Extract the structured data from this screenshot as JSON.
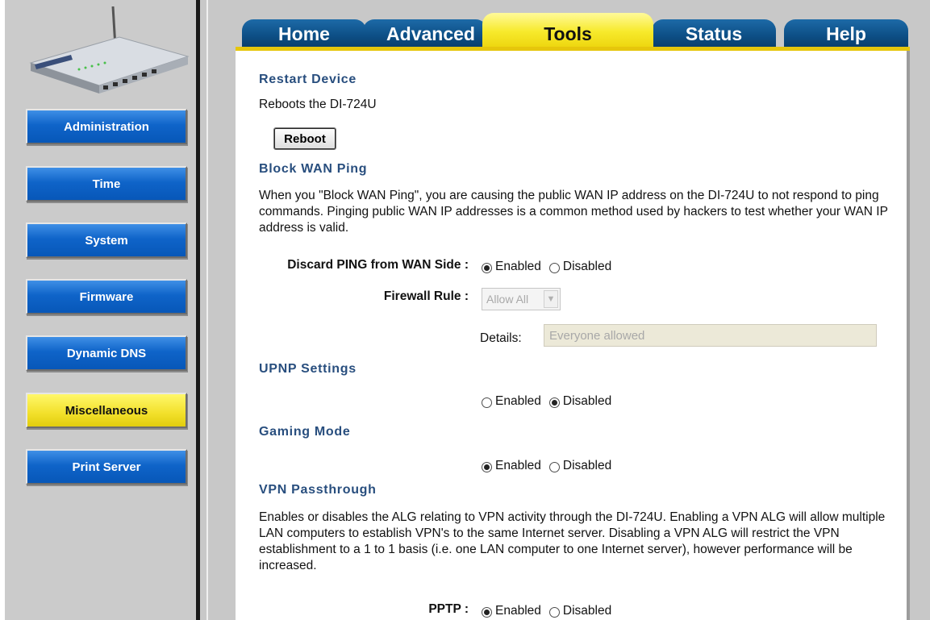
{
  "sidebar": {
    "items": [
      {
        "label": "Administration"
      },
      {
        "label": "Time"
      },
      {
        "label": "System"
      },
      {
        "label": "Firmware"
      },
      {
        "label": "Dynamic DNS"
      },
      {
        "label": "Miscellaneous",
        "active": true
      },
      {
        "label": "Print Server"
      }
    ]
  },
  "tabs": [
    {
      "label": "Home"
    },
    {
      "label": "Advanced"
    },
    {
      "label": "Tools",
      "active": true
    },
    {
      "label": "Status"
    },
    {
      "label": "Help"
    }
  ],
  "colors": {
    "tab_blue": "#0d4f86",
    "tab_active_yellow": "#f7ea2c",
    "side_button_blue": "#0f64c9",
    "heading_blue": "#284e7e"
  },
  "restart": {
    "heading": "Restart Device",
    "desc": "Reboots the DI-724U",
    "button": "Reboot"
  },
  "block_wan": {
    "heading": "Block WAN Ping",
    "desc": "When you \"Block WAN Ping\", you are causing the public WAN IP address on the DI-724U to not respond to ping commands. Pinging public WAN IP addresses is a common method used by hackers to test whether your WAN IP address is valid.",
    "discard_label": "Discard PING from WAN Side :",
    "discard_selected": "Enabled",
    "firewall_label": "Firewall Rule :",
    "firewall_value": "Allow All",
    "details_label": "Details:",
    "details_value": "Everyone allowed"
  },
  "upnp": {
    "heading": "UPNP Settings",
    "selected": "Disabled"
  },
  "gaming": {
    "heading": "Gaming Mode",
    "selected": "Enabled"
  },
  "vpn": {
    "heading": "VPN Passthrough",
    "desc": "Enables or disables the ALG relating to VPN activity through the DI-724U. Enabling a VPN ALG will allow multiple LAN computers to establish VPN's to the same Internet server. Disabling a VPN ALG will restrict the VPN establishment to a 1 to 1 basis (i.e. one LAN computer to one Internet server), however performance will be increased.",
    "pptp_label": "PPTP :",
    "pptp_selected": "Enabled"
  },
  "radio_labels": {
    "enabled": "Enabled",
    "disabled": "Disabled"
  },
  "icons": {
    "router": "router-image",
    "select_arrow": "chevron-down-icon"
  }
}
